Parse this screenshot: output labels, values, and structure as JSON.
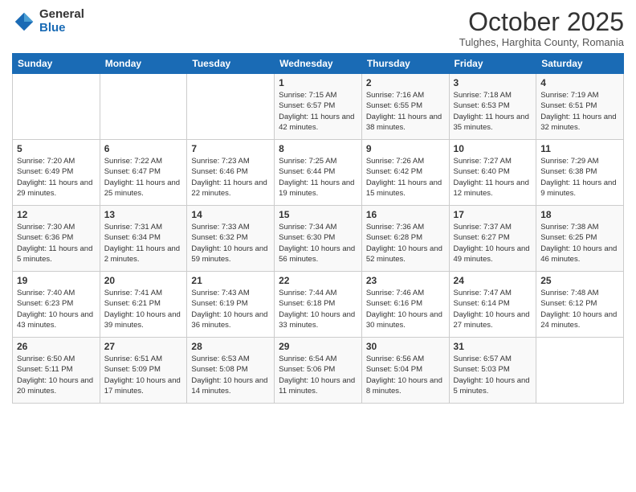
{
  "header": {
    "logo_general": "General",
    "logo_blue": "Blue",
    "month_title": "October 2025",
    "subtitle": "Tulghes, Harghita County, Romania"
  },
  "days_of_week": [
    "Sunday",
    "Monday",
    "Tuesday",
    "Wednesday",
    "Thursday",
    "Friday",
    "Saturday"
  ],
  "weeks": [
    [
      {
        "day": "",
        "sunrise": "",
        "sunset": "",
        "daylight": ""
      },
      {
        "day": "",
        "sunrise": "",
        "sunset": "",
        "daylight": ""
      },
      {
        "day": "",
        "sunrise": "",
        "sunset": "",
        "daylight": ""
      },
      {
        "day": "1",
        "sunrise": "Sunrise: 7:15 AM",
        "sunset": "Sunset: 6:57 PM",
        "daylight": "Daylight: 11 hours and 42 minutes."
      },
      {
        "day": "2",
        "sunrise": "Sunrise: 7:16 AM",
        "sunset": "Sunset: 6:55 PM",
        "daylight": "Daylight: 11 hours and 38 minutes."
      },
      {
        "day": "3",
        "sunrise": "Sunrise: 7:18 AM",
        "sunset": "Sunset: 6:53 PM",
        "daylight": "Daylight: 11 hours and 35 minutes."
      },
      {
        "day": "4",
        "sunrise": "Sunrise: 7:19 AM",
        "sunset": "Sunset: 6:51 PM",
        "daylight": "Daylight: 11 hours and 32 minutes."
      }
    ],
    [
      {
        "day": "5",
        "sunrise": "Sunrise: 7:20 AM",
        "sunset": "Sunset: 6:49 PM",
        "daylight": "Daylight: 11 hours and 29 minutes."
      },
      {
        "day": "6",
        "sunrise": "Sunrise: 7:22 AM",
        "sunset": "Sunset: 6:47 PM",
        "daylight": "Daylight: 11 hours and 25 minutes."
      },
      {
        "day": "7",
        "sunrise": "Sunrise: 7:23 AM",
        "sunset": "Sunset: 6:46 PM",
        "daylight": "Daylight: 11 hours and 22 minutes."
      },
      {
        "day": "8",
        "sunrise": "Sunrise: 7:25 AM",
        "sunset": "Sunset: 6:44 PM",
        "daylight": "Daylight: 11 hours and 19 minutes."
      },
      {
        "day": "9",
        "sunrise": "Sunrise: 7:26 AM",
        "sunset": "Sunset: 6:42 PM",
        "daylight": "Daylight: 11 hours and 15 minutes."
      },
      {
        "day": "10",
        "sunrise": "Sunrise: 7:27 AM",
        "sunset": "Sunset: 6:40 PM",
        "daylight": "Daylight: 11 hours and 12 minutes."
      },
      {
        "day": "11",
        "sunrise": "Sunrise: 7:29 AM",
        "sunset": "Sunset: 6:38 PM",
        "daylight": "Daylight: 11 hours and 9 minutes."
      }
    ],
    [
      {
        "day": "12",
        "sunrise": "Sunrise: 7:30 AM",
        "sunset": "Sunset: 6:36 PM",
        "daylight": "Daylight: 11 hours and 5 minutes."
      },
      {
        "day": "13",
        "sunrise": "Sunrise: 7:31 AM",
        "sunset": "Sunset: 6:34 PM",
        "daylight": "Daylight: 11 hours and 2 minutes."
      },
      {
        "day": "14",
        "sunrise": "Sunrise: 7:33 AM",
        "sunset": "Sunset: 6:32 PM",
        "daylight": "Daylight: 10 hours and 59 minutes."
      },
      {
        "day": "15",
        "sunrise": "Sunrise: 7:34 AM",
        "sunset": "Sunset: 6:30 PM",
        "daylight": "Daylight: 10 hours and 56 minutes."
      },
      {
        "day": "16",
        "sunrise": "Sunrise: 7:36 AM",
        "sunset": "Sunset: 6:28 PM",
        "daylight": "Daylight: 10 hours and 52 minutes."
      },
      {
        "day": "17",
        "sunrise": "Sunrise: 7:37 AM",
        "sunset": "Sunset: 6:27 PM",
        "daylight": "Daylight: 10 hours and 49 minutes."
      },
      {
        "day": "18",
        "sunrise": "Sunrise: 7:38 AM",
        "sunset": "Sunset: 6:25 PM",
        "daylight": "Daylight: 10 hours and 46 minutes."
      }
    ],
    [
      {
        "day": "19",
        "sunrise": "Sunrise: 7:40 AM",
        "sunset": "Sunset: 6:23 PM",
        "daylight": "Daylight: 10 hours and 43 minutes."
      },
      {
        "day": "20",
        "sunrise": "Sunrise: 7:41 AM",
        "sunset": "Sunset: 6:21 PM",
        "daylight": "Daylight: 10 hours and 39 minutes."
      },
      {
        "day": "21",
        "sunrise": "Sunrise: 7:43 AM",
        "sunset": "Sunset: 6:19 PM",
        "daylight": "Daylight: 10 hours and 36 minutes."
      },
      {
        "day": "22",
        "sunrise": "Sunrise: 7:44 AM",
        "sunset": "Sunset: 6:18 PM",
        "daylight": "Daylight: 10 hours and 33 minutes."
      },
      {
        "day": "23",
        "sunrise": "Sunrise: 7:46 AM",
        "sunset": "Sunset: 6:16 PM",
        "daylight": "Daylight: 10 hours and 30 minutes."
      },
      {
        "day": "24",
        "sunrise": "Sunrise: 7:47 AM",
        "sunset": "Sunset: 6:14 PM",
        "daylight": "Daylight: 10 hours and 27 minutes."
      },
      {
        "day": "25",
        "sunrise": "Sunrise: 7:48 AM",
        "sunset": "Sunset: 6:12 PM",
        "daylight": "Daylight: 10 hours and 24 minutes."
      }
    ],
    [
      {
        "day": "26",
        "sunrise": "Sunrise: 6:50 AM",
        "sunset": "Sunset: 5:11 PM",
        "daylight": "Daylight: 10 hours and 20 minutes."
      },
      {
        "day": "27",
        "sunrise": "Sunrise: 6:51 AM",
        "sunset": "Sunset: 5:09 PM",
        "daylight": "Daylight: 10 hours and 17 minutes."
      },
      {
        "day": "28",
        "sunrise": "Sunrise: 6:53 AM",
        "sunset": "Sunset: 5:08 PM",
        "daylight": "Daylight: 10 hours and 14 minutes."
      },
      {
        "day": "29",
        "sunrise": "Sunrise: 6:54 AM",
        "sunset": "Sunset: 5:06 PM",
        "daylight": "Daylight: 10 hours and 11 minutes."
      },
      {
        "day": "30",
        "sunrise": "Sunrise: 6:56 AM",
        "sunset": "Sunset: 5:04 PM",
        "daylight": "Daylight: 10 hours and 8 minutes."
      },
      {
        "day": "31",
        "sunrise": "Sunrise: 6:57 AM",
        "sunset": "Sunset: 5:03 PM",
        "daylight": "Daylight: 10 hours and 5 minutes."
      },
      {
        "day": "",
        "sunrise": "",
        "sunset": "",
        "daylight": ""
      }
    ]
  ]
}
